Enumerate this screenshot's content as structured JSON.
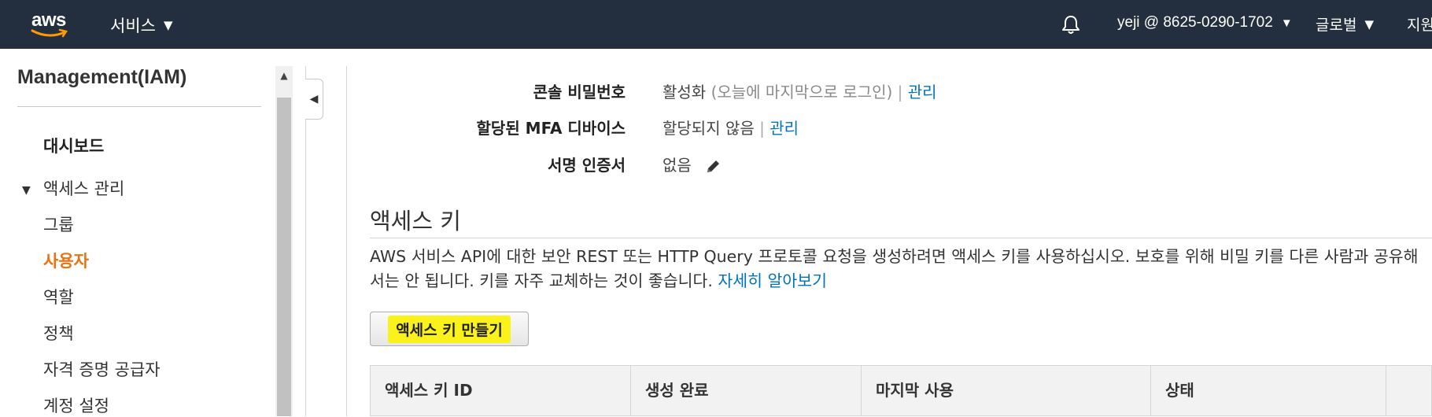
{
  "topnav": {
    "logo_text": "aws",
    "services_label": "서비스",
    "account_label": "yeji @ 8625-0290-1702",
    "region_label": "글로벌",
    "support_label": "지원",
    "caret": "▼"
  },
  "sidebar": {
    "title": "Management(IAM)",
    "dashboard": "대시보드",
    "access_mgmt": "액세스 관리",
    "items": [
      "그룹",
      "사용자",
      "역할",
      "정책",
      "자격 증명 공급자",
      "계정 설정"
    ],
    "active_item": "사용자",
    "expand_glyph": "▼",
    "scroll_up_glyph": "▲",
    "collapse_glyph": "◀"
  },
  "credentials": {
    "console_password": {
      "label": "콘솔 비밀번호",
      "value": "활성화",
      "note": "(오늘에 마지막으로 로그인)",
      "separator": "|",
      "link": "관리"
    },
    "mfa": {
      "label": "할당된 MFA 디바이스",
      "value": "할당되지 않음",
      "separator": "|",
      "link": "관리"
    },
    "signing_cert": {
      "label": "서명 인증서",
      "value": "없음"
    }
  },
  "access_keys": {
    "title": "액세스 키",
    "description": "AWS 서비스 API에 대한 보안 REST 또는 HTTP Query 프로토콜 요청을 생성하려면 액세스 키를 사용하십시오. 보호를 위해 비밀 키를 다른 사람과 공유해서는 안 됩니다. 키를 자주 교체하는 것이 좋습니다.",
    "learn_more": "자세히 알아보기",
    "create_button": "액세스 키 만들기",
    "highlight_color": "#faf21a",
    "columns": [
      "액세스 키 ID",
      "생성 완료",
      "마지막 사용",
      "상태",
      ""
    ]
  },
  "colors": {
    "nav_bg": "#232f3e",
    "active": "#ec7211",
    "link": "#0073bb"
  }
}
